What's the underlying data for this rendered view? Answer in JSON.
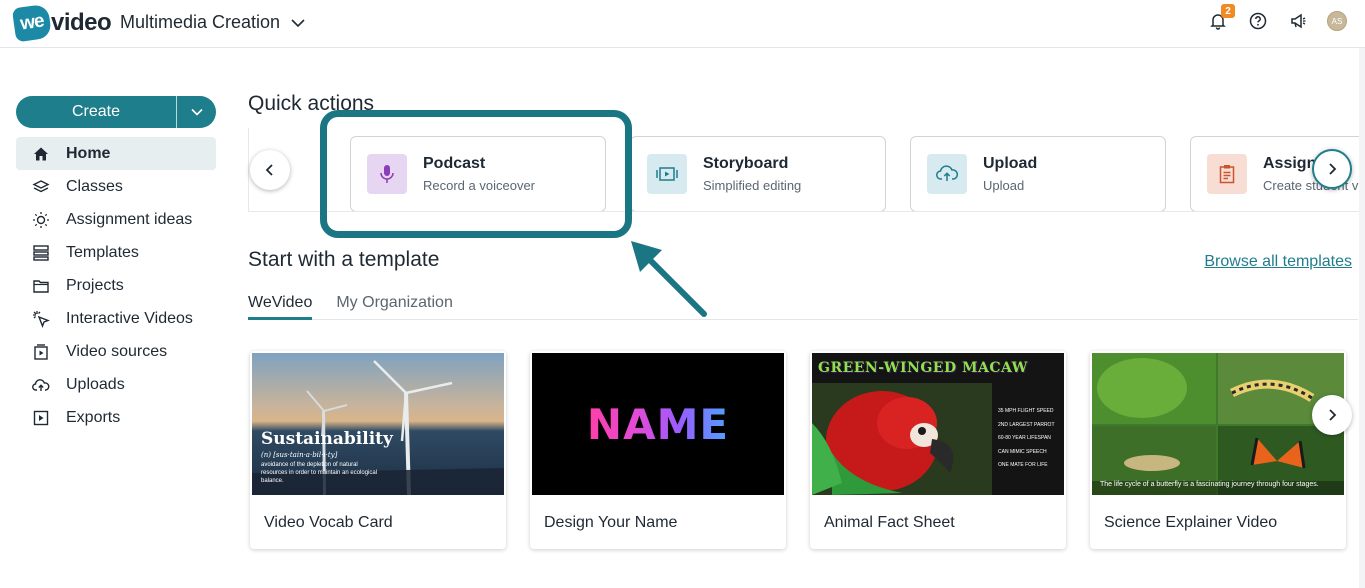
{
  "header": {
    "logo_badge": "we",
    "logo_text": "video",
    "workspace": "Multimedia Creation",
    "notification_count": "2",
    "avatar_initials": "AS"
  },
  "sidebar": {
    "create_label": "Create",
    "items": [
      {
        "label": "Home",
        "icon": "home-icon",
        "active": true
      },
      {
        "label": "Classes",
        "icon": "layers-icon"
      },
      {
        "label": "Assignment ideas",
        "icon": "lightbulb-icon"
      },
      {
        "label": "Templates",
        "icon": "templates-icon"
      },
      {
        "label": "Projects",
        "icon": "folder-icon"
      },
      {
        "label": "Interactive Videos",
        "icon": "cursor-click-icon"
      },
      {
        "label": "Video sources",
        "icon": "video-source-icon"
      },
      {
        "label": "Uploads",
        "icon": "cloud-upload-icon"
      },
      {
        "label": "Exports",
        "icon": "export-icon"
      }
    ]
  },
  "quick_actions": {
    "title": "Quick actions",
    "cards": [
      {
        "name": "Podcast",
        "sub": "Record a voiceover",
        "icon": "microphone-icon",
        "color": "#e6d6f2",
        "icon_color": "#8a3fb8"
      },
      {
        "name": "Storyboard",
        "sub": "Simplified editing",
        "icon": "storyboard-icon",
        "color": "#d6eaf0",
        "icon_color": "#1f7e8c"
      },
      {
        "name": "Upload",
        "sub": "Upload",
        "icon": "cloud-upload-icon",
        "color": "#d6eaf0",
        "icon_color": "#1f7e8c"
      },
      {
        "name": "Assign",
        "sub": "Create student v",
        "icon": "assignment-icon",
        "color": "#f7ddd4",
        "icon_color": "#c9542e"
      }
    ]
  },
  "templates": {
    "title": "Start with a template",
    "browse_label": "Browse all templates",
    "tabs": [
      "WeVideo",
      "My Organization"
    ],
    "cards": [
      {
        "name": "Video Vocab Card",
        "thumb_title": "Sustainability",
        "thumb_phon": "(n) [sus·tain·a·bil·i·ty]",
        "thumb_def": "avoidance of the depletion of natural resources in order to maintain an ecological balance."
      },
      {
        "name": "Design Your Name",
        "thumb_title": "NAME"
      },
      {
        "name": "Animal Fact Sheet",
        "thumb_title": "GREEN-WINGED MACAW",
        "facts": [
          "35 MPH FLIGHT SPEED",
          "2ND LARGEST PARROT",
          "60-80 YEAR LIFESPAN",
          "CAN MIMIC SPEECH",
          "ONE MATE FOR LIFE"
        ]
      },
      {
        "name": "Science Explainer Video",
        "thumb_caption": "The life cycle of a butterfly is a fascinating journey through four stages."
      }
    ]
  },
  "colors": {
    "accent": "#1f7e8c",
    "highlight": "#1a7683",
    "badge": "#f08a24"
  }
}
